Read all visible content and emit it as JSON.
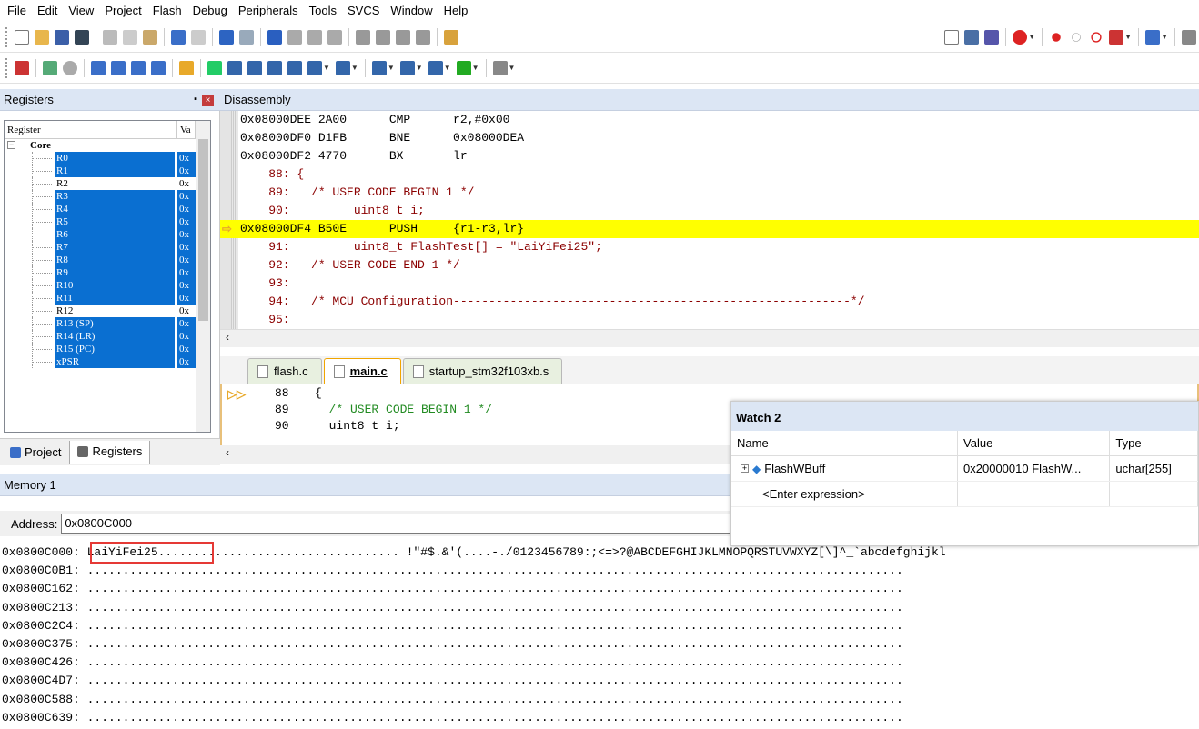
{
  "menu": [
    "File",
    "Edit",
    "View",
    "Project",
    "Flash",
    "Debug",
    "Peripherals",
    "Tools",
    "SVCS",
    "Window",
    "Help"
  ],
  "registers": {
    "title": "Registers",
    "col_register": "Register",
    "col_value": "Va",
    "group": "Core",
    "rows": [
      {
        "name": "R0",
        "value": "0x",
        "selected": true
      },
      {
        "name": "R1",
        "value": "0x",
        "selected": true
      },
      {
        "name": "R2",
        "value": "0x",
        "selected": false
      },
      {
        "name": "R3",
        "value": "0x",
        "selected": true
      },
      {
        "name": "R4",
        "value": "0x",
        "selected": true
      },
      {
        "name": "R5",
        "value": "0x",
        "selected": true
      },
      {
        "name": "R6",
        "value": "0x",
        "selected": true
      },
      {
        "name": "R7",
        "value": "0x",
        "selected": true
      },
      {
        "name": "R8",
        "value": "0x",
        "selected": true
      },
      {
        "name": "R9",
        "value": "0x",
        "selected": true
      },
      {
        "name": "R10",
        "value": "0x",
        "selected": true
      },
      {
        "name": "R11",
        "value": "0x",
        "selected": true
      },
      {
        "name": "R12",
        "value": "0x",
        "selected": false
      },
      {
        "name": "R13 (SP)",
        "value": "0x",
        "selected": true
      },
      {
        "name": "R14 (LR)",
        "value": "0x",
        "selected": true
      },
      {
        "name": "R15 (PC)",
        "value": "0x",
        "selected": true
      },
      {
        "name": "xPSR",
        "value": "0x",
        "selected": true
      }
    ],
    "tab_project": "Project",
    "tab_registers": "Registers"
  },
  "disassembly": {
    "title": "Disassembly",
    "lines": [
      {
        "text": "0x08000DEE 2A00      CMP      r2,#0x00",
        "kind": "addr"
      },
      {
        "text": "0x08000DF0 D1FB      BNE      0x08000DEA",
        "kind": "addr"
      },
      {
        "text": "0x08000DF2 4770      BX       lr",
        "kind": "addr"
      },
      {
        "text": "    88: {",
        "kind": "src"
      },
      {
        "text": "    89:   /* USER CODE BEGIN 1 */",
        "kind": "src"
      },
      {
        "text": "    90:         uint8_t i;",
        "kind": "src"
      },
      {
        "text": "0x08000DF4 B50E      PUSH     {r1-r3,lr}",
        "kind": "cur"
      },
      {
        "text": "    91:         uint8_t FlashTest[] = \"LaiYiFei25\";",
        "kind": "src"
      },
      {
        "text": "    92:   /* USER CODE END 1 */",
        "kind": "src"
      },
      {
        "text": "    93: ",
        "kind": "src"
      },
      {
        "text": "    94:   /* MCU Configuration--------------------------------------------------------*/",
        "kind": "src"
      },
      {
        "text": "    95: ",
        "kind": "src"
      }
    ]
  },
  "editor": {
    "tabs": [
      {
        "label": "flash.c",
        "active": false
      },
      {
        "label": "main.c",
        "active": true
      },
      {
        "label": "startup_stm32f103xb.s",
        "active": false
      }
    ],
    "lines": [
      {
        "num": "88",
        "code": "{"
      },
      {
        "num": "89",
        "code": "  /* USER CODE BEGIN 1 */"
      },
      {
        "num": "90",
        "code": "  uint8 t i;"
      }
    ]
  },
  "watch": {
    "title": "Watch 2",
    "col_name": "Name",
    "col_value": "Value",
    "col_type": "Type",
    "rows": [
      {
        "name": "FlashWBuff",
        "value": "0x20000010 FlashW...",
        "type": "uchar[255]"
      },
      {
        "name": "<Enter expression>",
        "value": "",
        "type": ""
      }
    ]
  },
  "memory": {
    "title": "Memory 1",
    "address_label": "Address:",
    "address_value": "0x0800C000",
    "lines": [
      "0x0800C000: LaiYiFei25.................................. !\"#$.&'(....-./0123456789:;<=>?@ABCDEFGHIJKLMNOPQRSTUVWXYZ[\\]^_`abcdefghijkl",
      "0x0800C0B1: ...................................................................................................................",
      "0x0800C162: ...................................................................................................................",
      "0x0800C213: ...................................................................................................................",
      "0x0800C2C4: ...................................................................................................................",
      "0x0800C375: ...................................................................................................................",
      "0x0800C426: ...................................................................................................................",
      "0x0800C4D7: ...................................................................................................................",
      "0x0800C588: ...................................................................................................................",
      "0x0800C639: ..................................................................................................................."
    ]
  },
  "colors": {
    "highlight": "#ffff00",
    "selection": "#0a6fd1",
    "annotation_box": "#e53935"
  }
}
